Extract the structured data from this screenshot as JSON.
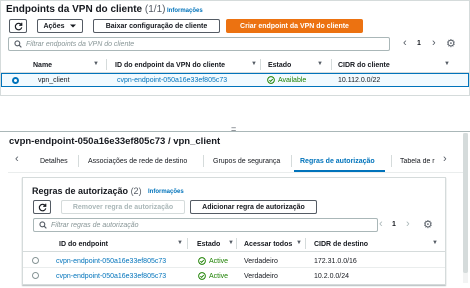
{
  "top": {
    "title": "Endpoints da VPN do cliente",
    "count": "(1/1)",
    "info_link": "Informações",
    "actions_label": "Ações",
    "download_config_label": "Baixar configuração de cliente",
    "create_endpoint_label": "Criar endpoint da VPN do cliente",
    "search_placeholder": "Filtrar endpoints da VPN do cliente",
    "page_number": "1",
    "columns": [
      "Name",
      "ID do endpoint da VPN do cliente",
      "Estado",
      "CIDR do cliente"
    ],
    "row": {
      "name": "vpn_client",
      "endpoint_id": "cvpn-endpoint-050a16e33ef805c73",
      "status": "Available",
      "cidr": "10.112.0.0/22"
    }
  },
  "detail": {
    "title": "cvpn-endpoint-050a16e33ef805c73 / vpn_client",
    "tabs": [
      "Detalhes",
      "Associações de rede de destino",
      "Grupos de segurança",
      "Regras de autorização",
      "Tabela de r"
    ],
    "active_tab_index": 3
  },
  "rules": {
    "title": "Regras de autorização",
    "count": "(2)",
    "info_link": "Informações",
    "remove_label": "Remover regra de autorização",
    "add_label": "Adicionar regra de autorização",
    "search_placeholder": "Filtrar regras de autorização",
    "page_number": "1",
    "columns": [
      "ID do endpoint",
      "Estado",
      "Acessar todos",
      "CIDR de destino"
    ],
    "rows": [
      {
        "endpoint_id": "cvpn-endpoint-050a16e33ef805c73",
        "status": "Active",
        "access_all": "Verdadeiro",
        "cidr": "172.31.0.0/16"
      },
      {
        "endpoint_id": "cvpn-endpoint-050a16e33ef805c73",
        "status": "Active",
        "access_all": "Verdadeiro",
        "cidr": "10.2.0.0/24"
      }
    ]
  },
  "colors": {
    "accent": "#ec7211",
    "link": "#0073bb",
    "success": "#1d8102",
    "selected_row": "#f1faff"
  }
}
